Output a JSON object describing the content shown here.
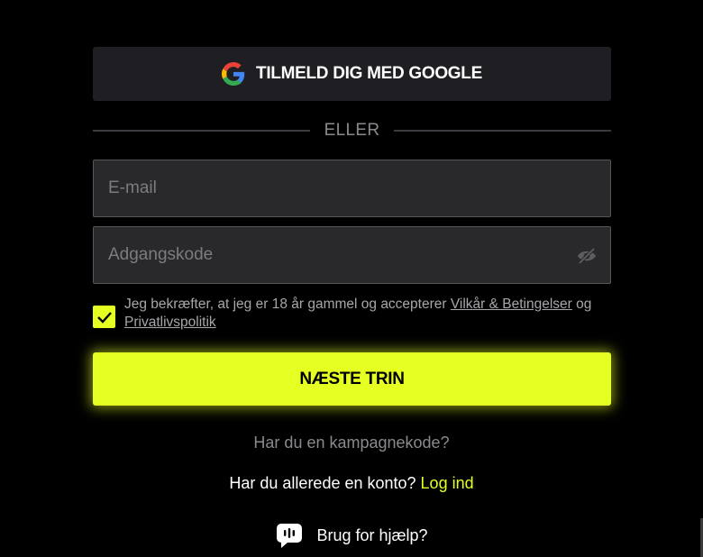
{
  "google_button": {
    "label": "TILMELD DIG MED GOOGLE",
    "icon": "google-icon"
  },
  "divider": {
    "label": "ELLER"
  },
  "email": {
    "placeholder": "E-mail",
    "value": ""
  },
  "password": {
    "placeholder": "Adgangskode",
    "value": "",
    "toggle_icon": "eye-slash-icon"
  },
  "consent": {
    "checked": true,
    "text_before": "Jeg bekræfter, at jeg er 18 år gammel og accepterer ",
    "terms_link": "Vilkår & Betingelser",
    "text_middle": " og ",
    "privacy_link": "Privatlivspolitik"
  },
  "next_button": {
    "label": "NÆSTE TRIN"
  },
  "promo": {
    "label": "Har du en kampagnekode?"
  },
  "login": {
    "prompt": "Har du allerede en konto? ",
    "link": "Log ind"
  },
  "help": {
    "label": "Brug for hjælp?",
    "icon": "chat-icon"
  },
  "colors": {
    "accent": "#e5ff22",
    "background": "#000000",
    "field_bg": "#29292c",
    "button_bg": "#1f1f23"
  }
}
